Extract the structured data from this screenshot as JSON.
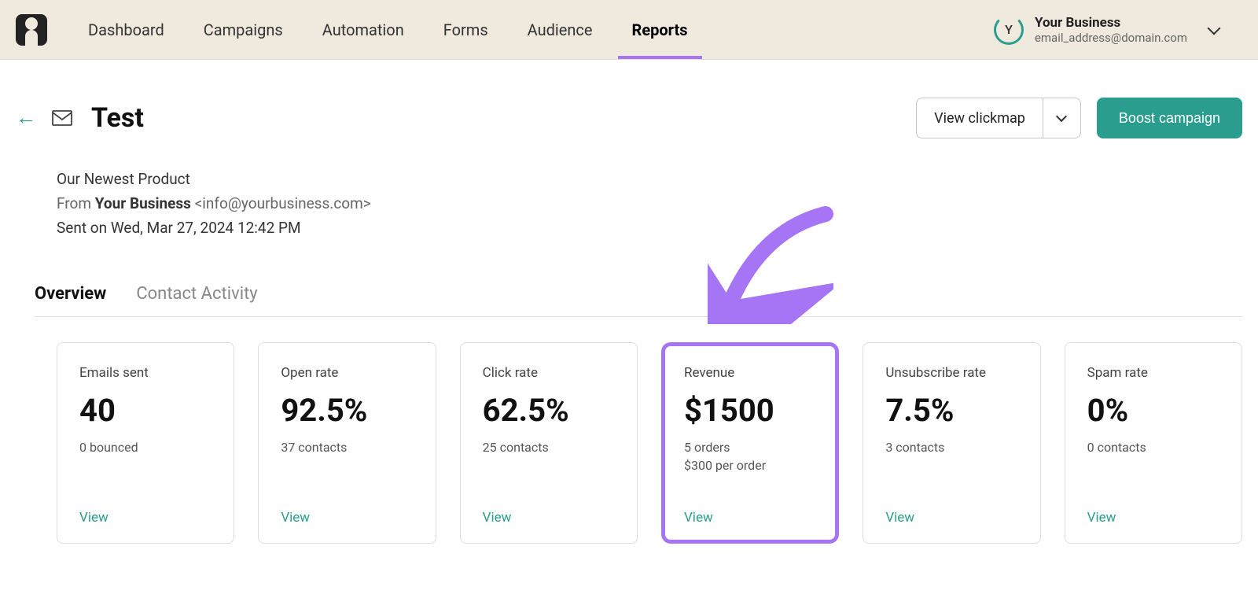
{
  "nav": {
    "items": [
      "Dashboard",
      "Campaigns",
      "Automation",
      "Forms",
      "Audience",
      "Reports"
    ],
    "active_index": 5
  },
  "account": {
    "initial": "Y",
    "name": "Your Business",
    "email": "email_address@domain.com"
  },
  "page": {
    "title": "Test",
    "subject": "Our Newest Product",
    "from_label": "From ",
    "from_name": "Your Business",
    "from_email": " <info@yourbusiness.com>",
    "sent_on": "Sent on Wed, Mar 27, 2024 12:42 PM",
    "view_clickmap": "View clickmap",
    "boost_campaign": "Boost campaign"
  },
  "tabs": {
    "items": [
      "Overview",
      "Contact Activity"
    ],
    "active_index": 0
  },
  "cards": [
    {
      "label": "Emails sent",
      "value": "40",
      "subs": [
        "0 bounced"
      ],
      "link": "View",
      "highlighted": false
    },
    {
      "label": "Open rate",
      "value": "92.5%",
      "subs": [
        "37 contacts"
      ],
      "link": "View",
      "highlighted": false
    },
    {
      "label": "Click rate",
      "value": "62.5%",
      "subs": [
        "25 contacts"
      ],
      "link": "View",
      "highlighted": false
    },
    {
      "label": "Revenue",
      "value": "$1500",
      "subs": [
        "5 orders",
        "$300 per order"
      ],
      "link": "View",
      "highlighted": true
    },
    {
      "label": "Unsubscribe rate",
      "value": "7.5%",
      "subs": [
        "3 contacts"
      ],
      "link": "View",
      "highlighted": false
    },
    {
      "label": "Spam rate",
      "value": "0%",
      "subs": [
        "0 contacts"
      ],
      "link": "View",
      "highlighted": false
    }
  ],
  "colors": {
    "accent": "#2a9d8f",
    "highlight": "#a675f5",
    "topbar_bg": "#f0e9dd"
  }
}
